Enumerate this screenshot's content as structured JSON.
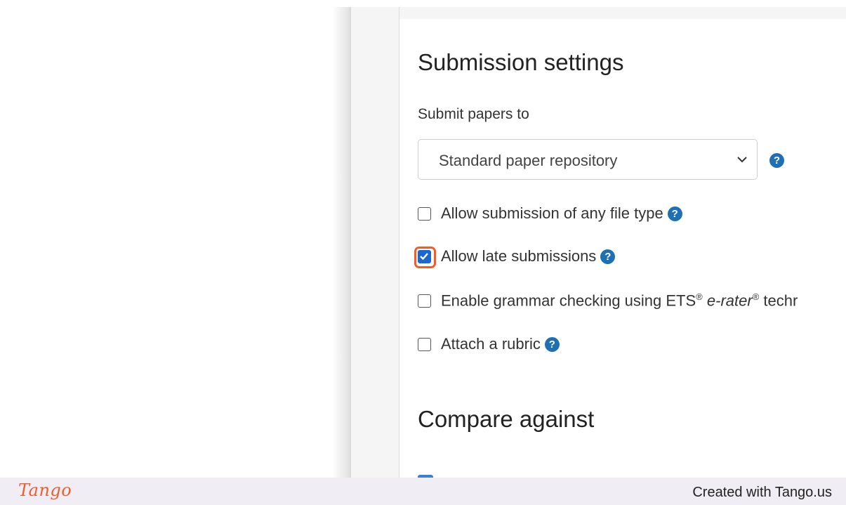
{
  "submission": {
    "heading": "Submission settings",
    "submit_to_label": "Submit papers to",
    "repository_select": {
      "selected": "Standard paper repository"
    },
    "options": {
      "any_file": {
        "label": "Allow submission of any file type",
        "checked": false
      },
      "late": {
        "label": "Allow late submissions",
        "checked": true
      },
      "grammar": {
        "label_prefix": "Enable grammar checking using ETS",
        "reg": "®",
        "erater": "e-rater",
        "label_suffix": " techr",
        "checked": false
      },
      "rubric": {
        "label": "Attach a rubric",
        "checked": false
      }
    },
    "help_glyph": "?"
  },
  "compare": {
    "heading": "Compare against"
  },
  "footer": {
    "logo": "Tango",
    "credit": "Created with Tango.us"
  },
  "colors": {
    "accent_blue": "#1f6fb5",
    "checkbox_blue": "#1a66d4",
    "focus_orange": "#f05d2a",
    "footer_bg": "#f0edf5"
  }
}
